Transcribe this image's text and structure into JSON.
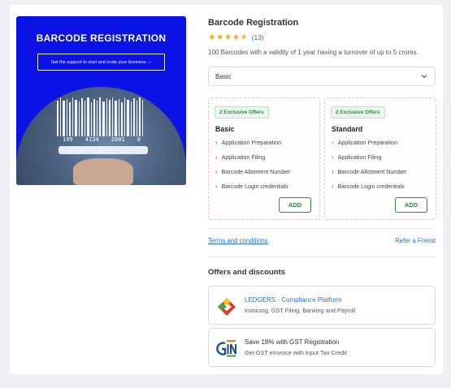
{
  "hero": {
    "title": "BARCODE REGISTRATION",
    "tagline": "Get the support to start and scale your business",
    "barcode_digits": [
      "109",
      "4134",
      "2001",
      "8"
    ]
  },
  "product": {
    "title": "Barcode Registration",
    "rating_stars": 4.5,
    "rating_count": "(13)",
    "description": "100 Barcodes with a validity of 1 year having a turnover of up to 5 crores."
  },
  "plan_select": {
    "selected": "Basic"
  },
  "plans": [
    {
      "badge": "2 Exclusive Offers",
      "name": "Basic",
      "features": [
        "Application Preparation",
        "Application Filing",
        "Barcode Allotment Number",
        "Barcode Login credentials"
      ],
      "add_label": "ADD"
    },
    {
      "badge": "2 Exclusive Offers",
      "name": "Standard",
      "features": [
        "Application Preparation",
        "Application Filing",
        "Barcode Allotment Number",
        "Barcode Login credentials"
      ],
      "add_label": "ADD"
    }
  ],
  "links": {
    "terms": "Terms and conditions",
    "refer": "Refer a Friend"
  },
  "offers": {
    "heading": "Offers and discounts",
    "items": [
      {
        "title": "LEDGERS - Compliance Platform",
        "subtitle": "Invoicing, GST Filing, Banking and Payroll",
        "icon": "ledgers-logo-icon"
      },
      {
        "title": "Save 18% with GST Registration",
        "subtitle": "Get GST eInvoice with Input Tax Credit",
        "icon": "gst-logo-icon"
      }
    ]
  },
  "colors": {
    "accent_blue": "#2a6ed1",
    "green": "#2e8a3e",
    "hero_blue": "#0a12e6",
    "star": "#f5a623"
  }
}
